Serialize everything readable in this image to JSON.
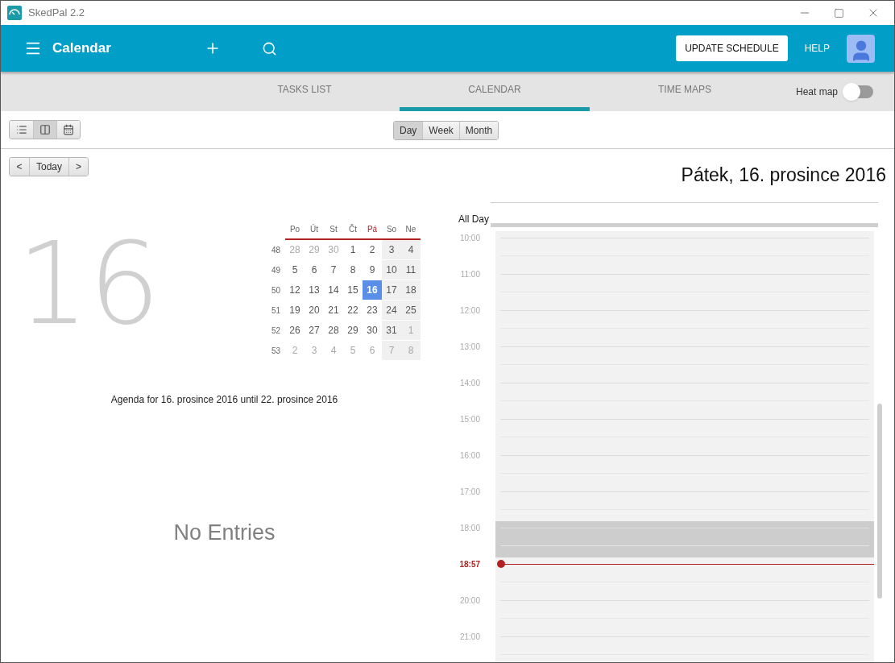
{
  "window": {
    "title": "SkedPal 2.2"
  },
  "header": {
    "title": "Calendar",
    "update_button": "UPDATE SCHEDULE",
    "help": "HELP"
  },
  "tabs": [
    {
      "label": "TASKS LIST",
      "selected": false
    },
    {
      "label": "CALENDAR",
      "selected": true
    },
    {
      "label": "TIME MAPS",
      "selected": false
    }
  ],
  "heat_map": {
    "label": "Heat map",
    "on": false
  },
  "view_buttons": [
    {
      "kind": "list",
      "selected": false
    },
    {
      "kind": "split",
      "selected": true
    },
    {
      "kind": "calendar",
      "selected": false
    }
  ],
  "range_buttons": [
    {
      "label": "Day",
      "selected": true
    },
    {
      "label": "Week",
      "selected": false
    },
    {
      "label": "Month",
      "selected": false
    }
  ],
  "nav": {
    "prev": "<",
    "today": "Today",
    "next": ">"
  },
  "date_title": "Pátek, 16. prosince 2016",
  "big_day": "16",
  "mini_calendar": {
    "weekdays": [
      {
        "label": "Po",
        "selected": false
      },
      {
        "label": "Út",
        "selected": false
      },
      {
        "label": "St",
        "selected": false
      },
      {
        "label": "Čt",
        "selected": false
      },
      {
        "label": "Pá",
        "selected": true
      },
      {
        "label": "So",
        "selected": false
      },
      {
        "label": "Ne",
        "selected": false
      }
    ],
    "weeks": [
      {
        "number": "48",
        "days": [
          {
            "label": "28",
            "other_month": true,
            "selected": false
          },
          {
            "label": "29",
            "other_month": true,
            "selected": false
          },
          {
            "label": "30",
            "other_month": true,
            "selected": false
          },
          {
            "label": "1",
            "other_month": false,
            "selected": false
          },
          {
            "label": "2",
            "other_month": false,
            "selected": false
          },
          {
            "label": "3",
            "other_month": false,
            "selected": false
          },
          {
            "label": "4",
            "other_month": false,
            "selected": false
          }
        ]
      },
      {
        "number": "49",
        "days": [
          {
            "label": "5",
            "other_month": false,
            "selected": false
          },
          {
            "label": "6",
            "other_month": false,
            "selected": false
          },
          {
            "label": "7",
            "other_month": false,
            "selected": false
          },
          {
            "label": "8",
            "other_month": false,
            "selected": false
          },
          {
            "label": "9",
            "other_month": false,
            "selected": false
          },
          {
            "label": "10",
            "other_month": false,
            "selected": false
          },
          {
            "label": "11",
            "other_month": false,
            "selected": false
          }
        ]
      },
      {
        "number": "50",
        "days": [
          {
            "label": "12",
            "other_month": false,
            "selected": false
          },
          {
            "label": "13",
            "other_month": false,
            "selected": false
          },
          {
            "label": "14",
            "other_month": false,
            "selected": false
          },
          {
            "label": "15",
            "other_month": false,
            "selected": false
          },
          {
            "label": "16",
            "other_month": false,
            "selected": true
          },
          {
            "label": "17",
            "other_month": false,
            "selected": false
          },
          {
            "label": "18",
            "other_month": false,
            "selected": false
          }
        ]
      },
      {
        "number": "51",
        "days": [
          {
            "label": "19",
            "other_month": false,
            "selected": false
          },
          {
            "label": "20",
            "other_month": false,
            "selected": false
          },
          {
            "label": "21",
            "other_month": false,
            "selected": false
          },
          {
            "label": "22",
            "other_month": false,
            "selected": false
          },
          {
            "label": "23",
            "other_month": false,
            "selected": false
          },
          {
            "label": "24",
            "other_month": false,
            "selected": false
          },
          {
            "label": "25",
            "other_month": false,
            "selected": false
          }
        ]
      },
      {
        "number": "52",
        "days": [
          {
            "label": "26",
            "other_month": false,
            "selected": false
          },
          {
            "label": "27",
            "other_month": false,
            "selected": false
          },
          {
            "label": "28",
            "other_month": false,
            "selected": false
          },
          {
            "label": "29",
            "other_month": false,
            "selected": false
          },
          {
            "label": "30",
            "other_month": false,
            "selected": false
          },
          {
            "label": "31",
            "other_month": false,
            "selected": false
          },
          {
            "label": "1",
            "other_month": true,
            "selected": false
          }
        ]
      },
      {
        "number": "53",
        "days": [
          {
            "label": "2",
            "other_month": true,
            "selected": false
          },
          {
            "label": "3",
            "other_month": true,
            "selected": false
          },
          {
            "label": "4",
            "other_month": true,
            "selected": false
          },
          {
            "label": "5",
            "other_month": true,
            "selected": false
          },
          {
            "label": "6",
            "other_month": true,
            "selected": false
          },
          {
            "label": "7",
            "other_month": true,
            "selected": false
          },
          {
            "label": "8",
            "other_month": true,
            "selected": false
          }
        ]
      }
    ]
  },
  "agenda_title": "Agenda for 16. prosince 2016 until 22. prosince 2016",
  "empty_message": "No Entries",
  "day_view": {
    "all_day_label": "All Day",
    "hours": [
      {
        "label": "10:00",
        "kind": "hour",
        "shaded": false
      },
      {
        "label": "11:00",
        "kind": "hour",
        "shaded": false
      },
      {
        "label": "12:00",
        "kind": "hour",
        "shaded": false
      },
      {
        "label": "13:00",
        "kind": "hour",
        "shaded": false
      },
      {
        "label": "14:00",
        "kind": "hour",
        "shaded": false
      },
      {
        "label": "15:00",
        "kind": "hour",
        "shaded": false
      },
      {
        "label": "16:00",
        "kind": "hour",
        "shaded": false
      },
      {
        "label": "17:00",
        "kind": "hour",
        "shaded": false
      },
      {
        "label": "18:00",
        "kind": "hour",
        "shaded": true
      },
      {
        "label": "18:57",
        "kind": "now",
        "shaded": false
      },
      {
        "label": "20:00",
        "kind": "hour",
        "shaded": false
      },
      {
        "label": "21:00",
        "kind": "hour",
        "shaded": false
      }
    ]
  }
}
